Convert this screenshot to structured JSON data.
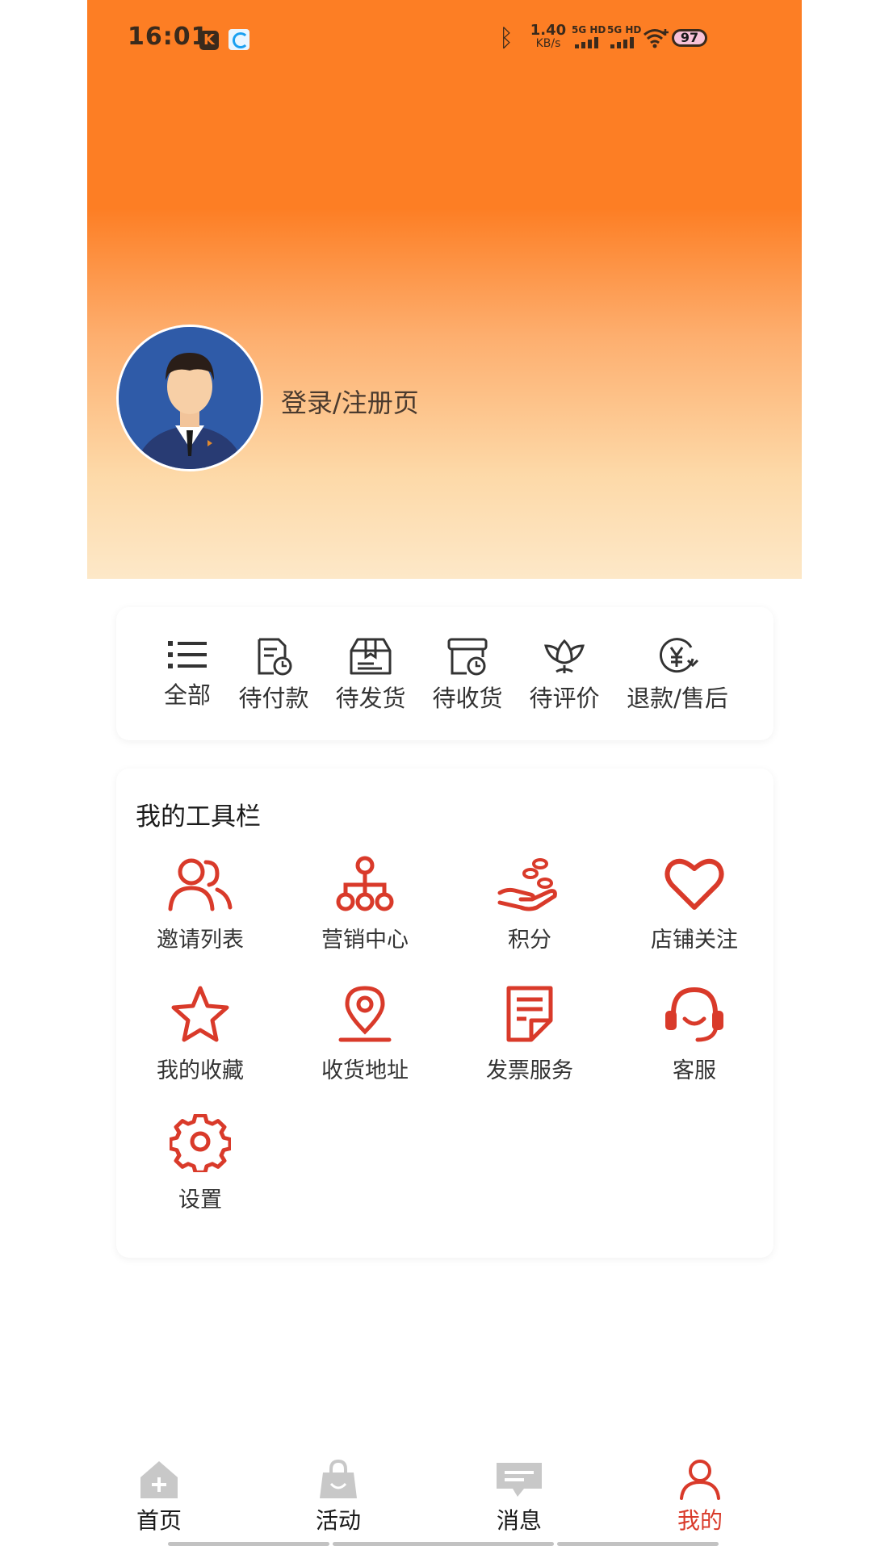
{
  "status_bar": {
    "time": "16:01",
    "net_speed_value": "1.40",
    "net_speed_unit": "KB/s",
    "sim1_label": "5G HD",
    "sim2_label": "5G HD",
    "battery": "97"
  },
  "profile": {
    "login_text": "登录/注册页"
  },
  "orders": [
    {
      "label": "全部",
      "icon": "list-icon"
    },
    {
      "label": "待付款",
      "icon": "bill-clock-icon"
    },
    {
      "label": "待发货",
      "icon": "package-box-icon"
    },
    {
      "label": "待收货",
      "icon": "receive-clock-icon"
    },
    {
      "label": "待评价",
      "icon": "lotus-icon"
    },
    {
      "label": "退款/售后",
      "icon": "yuan-refund-icon"
    }
  ],
  "tools": {
    "title": "我的工具栏",
    "items": [
      {
        "label": "邀请列表",
        "icon": "users-icon"
      },
      {
        "label": "营销中心",
        "icon": "org-tree-icon"
      },
      {
        "label": "积分",
        "icon": "hand-coins-icon"
      },
      {
        "label": "店铺关注",
        "icon": "heart-icon"
      },
      {
        "label": "我的收藏",
        "icon": "star-icon"
      },
      {
        "label": "收货地址",
        "icon": "location-pin-icon"
      },
      {
        "label": "发票服务",
        "icon": "invoice-icon"
      },
      {
        "label": "客服",
        "icon": "headset-icon"
      },
      {
        "label": "设置",
        "icon": "gear-icon"
      }
    ]
  },
  "bottom_nav": [
    {
      "label": "首页",
      "icon": "home-icon"
    },
    {
      "label": "活动",
      "icon": "shopping-bag-icon"
    },
    {
      "label": "消息",
      "icon": "message-icon"
    },
    {
      "label": "我的",
      "icon": "profile-icon"
    }
  ],
  "colors": {
    "accent_red": "#d93a2a",
    "header_orange": "#fd7e24",
    "header_cream": "#fde8c8",
    "nav_inactive": "#c8c8c8"
  }
}
